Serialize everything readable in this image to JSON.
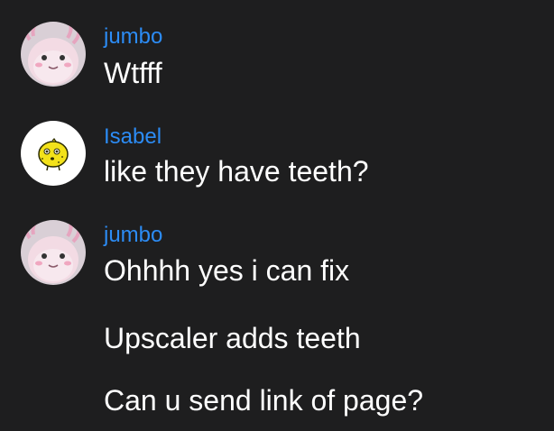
{
  "messages": [
    {
      "author": "jumbo",
      "avatar_icon": "axolotl-avatar-icon",
      "lines": [
        "Wtfff"
      ]
    },
    {
      "author": "Isabel",
      "avatar_icon": "lemon-avatar-icon",
      "lines": [
        "like they have teeth?"
      ]
    },
    {
      "author": "jumbo",
      "avatar_icon": "axolotl-avatar-icon",
      "lines": [
        "Ohhhh yes i can fix",
        "Upscaler adds teeth",
        "Can u send link of page?"
      ]
    }
  ],
  "colors": {
    "background": "#1e1e1f",
    "author_name": "#2c8cf5",
    "message_text": "#ffffff"
  }
}
